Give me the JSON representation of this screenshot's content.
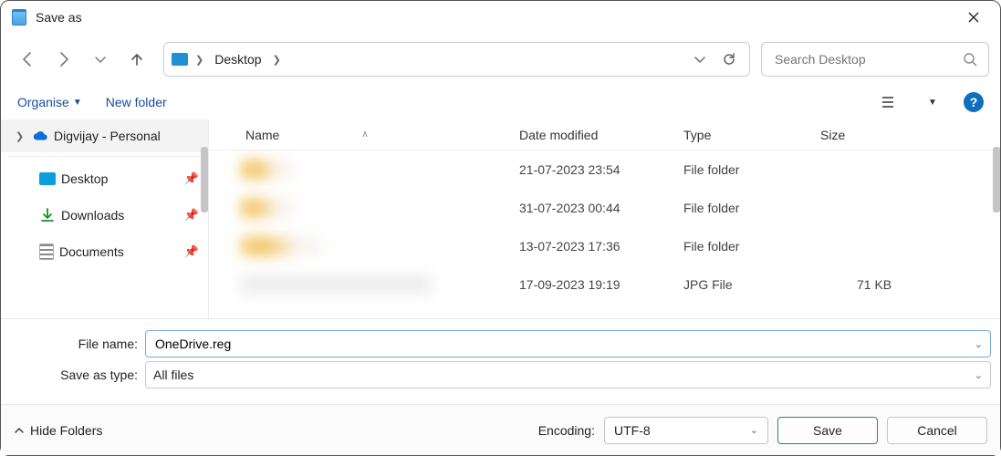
{
  "title": "Save as",
  "address": {
    "location": "Desktop"
  },
  "search": {
    "placeholder": "Search Desktop"
  },
  "toolbar": {
    "organise": "Organise",
    "newfolder": "New folder"
  },
  "sidebar": {
    "onedrive": "Digvijay - Personal",
    "items": [
      {
        "label": "Desktop"
      },
      {
        "label": "Downloads"
      },
      {
        "label": "Documents"
      }
    ]
  },
  "columns": {
    "name": "Name",
    "date": "Date modified",
    "type": "Type",
    "size": "Size"
  },
  "rows": [
    {
      "date": "21-07-2023 23:54",
      "type": "File folder",
      "size": ""
    },
    {
      "date": "31-07-2023 00:44",
      "type": "File folder",
      "size": ""
    },
    {
      "date": "13-07-2023 17:36",
      "type": "File folder",
      "size": ""
    },
    {
      "date": "17-09-2023 19:19",
      "type": "JPG File",
      "size": "71 KB"
    }
  ],
  "fields": {
    "filename_label": "File name:",
    "filename_value": "OneDrive.reg",
    "saveastype_label": "Save as type:",
    "saveastype_value": "All files"
  },
  "footer": {
    "hidefolders": "Hide Folders",
    "encoding_label": "Encoding:",
    "encoding_value": "UTF-8",
    "save": "Save",
    "cancel": "Cancel"
  }
}
